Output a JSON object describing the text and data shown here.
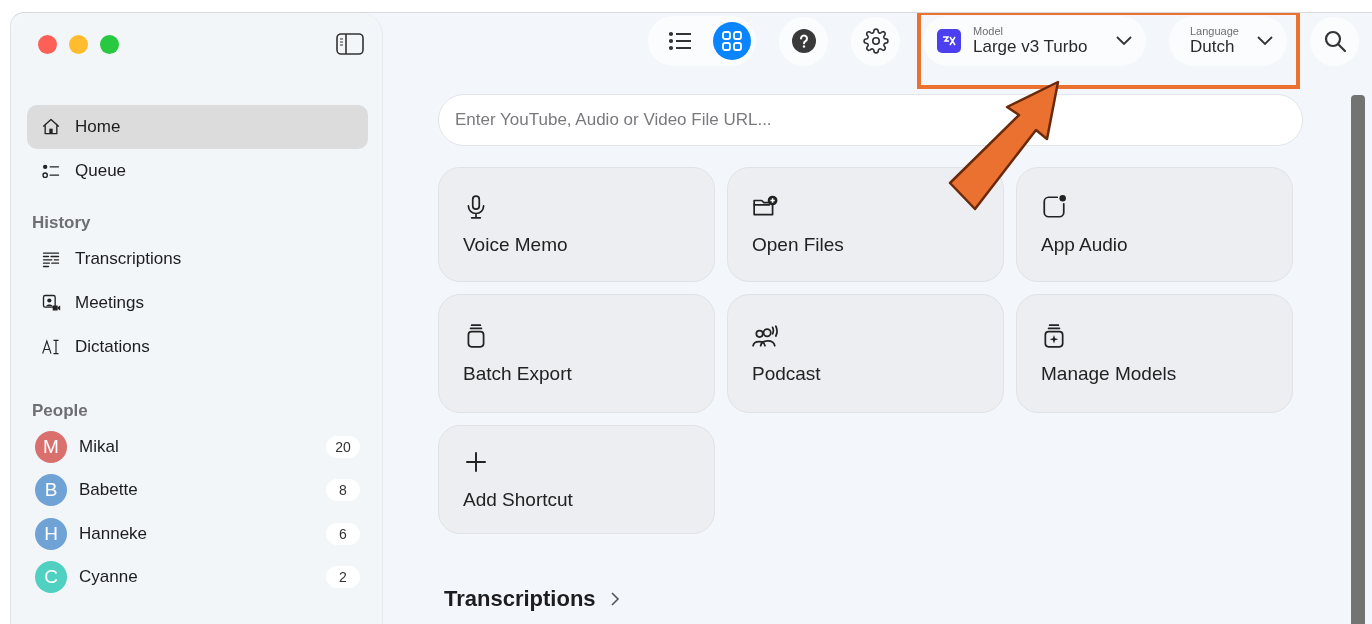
{
  "sidebar": {
    "nav": [
      {
        "label": "Home",
        "selected": true
      },
      {
        "label": "Queue",
        "selected": false
      }
    ],
    "history": {
      "title": "History",
      "items": [
        {
          "label": "Transcriptions",
          "selected": false
        },
        {
          "label": "Meetings",
          "selected": false
        },
        {
          "label": "Dictations",
          "selected": false
        }
      ]
    },
    "people": {
      "title": "People",
      "items": [
        {
          "initial": "M",
          "name": "Mikal",
          "count": "20",
          "color": "#d9706e"
        },
        {
          "initial": "B",
          "name": "Babette",
          "count": "8",
          "color": "#6fa3d6"
        },
        {
          "initial": "H",
          "name": "Hanneke",
          "count": "6",
          "color": "#6fa3d6"
        },
        {
          "initial": "C",
          "name": "Cyanne",
          "count": "2",
          "color": "#4fd0c0"
        }
      ]
    }
  },
  "toolbar": {
    "views": [
      {
        "kind": "list",
        "selected": false
      },
      {
        "kind": "grid",
        "selected": true
      }
    ],
    "model": {
      "label": "Model",
      "value": "Large v3 Turbo"
    },
    "language": {
      "label": "Language",
      "value": "Dutch"
    }
  },
  "url_field": {
    "placeholder": "Enter YouTube, Audio or Video File URL..."
  },
  "shortcuts": [
    {
      "label": "Voice Memo"
    },
    {
      "label": "Open Files"
    },
    {
      "label": "App Audio"
    },
    {
      "label": "Batch Export"
    },
    {
      "label": "Podcast"
    },
    {
      "label": "Manage Models"
    },
    {
      "label": "Add Shortcut"
    }
  ],
  "section": {
    "title": "Transcriptions"
  }
}
